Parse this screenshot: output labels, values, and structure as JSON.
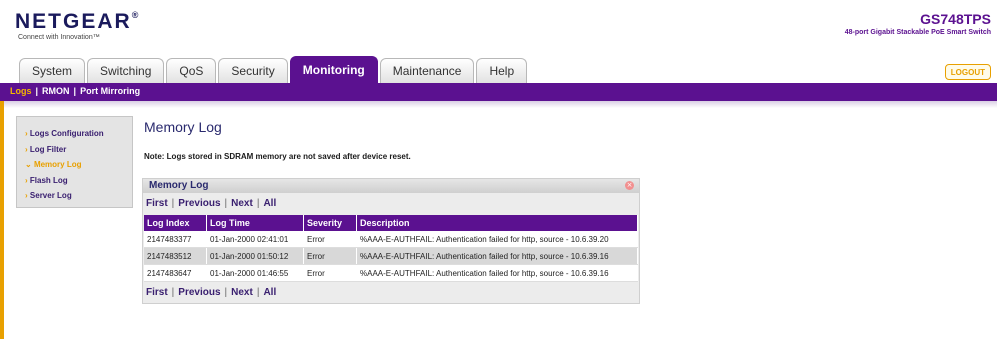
{
  "header": {
    "brand": "NETGEAR",
    "brand_mark": "®",
    "tagline": "Connect with Innovation™",
    "product_name": "GS748TPS",
    "product_desc": "48-port Gigabit Stackable PoE Smart Switch",
    "logout_label": "LOGOUT"
  },
  "tabs": [
    {
      "label": "System"
    },
    {
      "label": "Switching"
    },
    {
      "label": "QoS"
    },
    {
      "label": "Security"
    },
    {
      "label": "Monitoring",
      "active": true
    },
    {
      "label": "Maintenance"
    },
    {
      "label": "Help"
    }
  ],
  "subnav": {
    "items": [
      "Logs",
      "RMON",
      "Port Mirroring"
    ],
    "separator": "|",
    "selected": "Logs"
  },
  "sidebar": {
    "items": [
      {
        "label": "Logs Configuration",
        "selected": false
      },
      {
        "label": "Log Filter",
        "selected": false
      },
      {
        "label": "Memory Log",
        "selected": true
      },
      {
        "label": "Flash Log",
        "selected": false
      },
      {
        "label": "Server Log",
        "selected": false
      }
    ]
  },
  "main": {
    "title": "Memory Log",
    "note": "Note: Logs stored in SDRAM memory are not saved after device reset.",
    "panel_title": "Memory Log",
    "pager": {
      "first": "First",
      "previous": "Previous",
      "next": "Next",
      "all": "All",
      "sep": "|"
    },
    "table": {
      "columns": [
        "Log Index",
        "Log Time",
        "Severity",
        "Description"
      ],
      "rows": [
        [
          "2147483377",
          "01-Jan-2000 02:41:01",
          "Error",
          "%AAA-E-AUTHFAIL: Authentication failed for http, source - 10.6.39.20"
        ],
        [
          "2147483512",
          "01-Jan-2000 01:50:12",
          "Error",
          "%AAA-E-AUTHFAIL: Authentication failed for http, source - 10.6.39.16"
        ],
        [
          "2147483647",
          "01-Jan-2000 01:46:55",
          "Error",
          "%AAA-E-AUTHFAIL: Authentication failed for http, source - 10.6.39.16"
        ]
      ]
    }
  },
  "colors": {
    "brand_purple": "#5b1190",
    "accent_orange": "#e8a000",
    "logo_navy": "#1a1a5c"
  },
  "icons": {
    "sidebar_bullet": "chevron-right-icon",
    "sidebar_selected": "chevron-down-icon",
    "panel_close": "close-icon"
  }
}
